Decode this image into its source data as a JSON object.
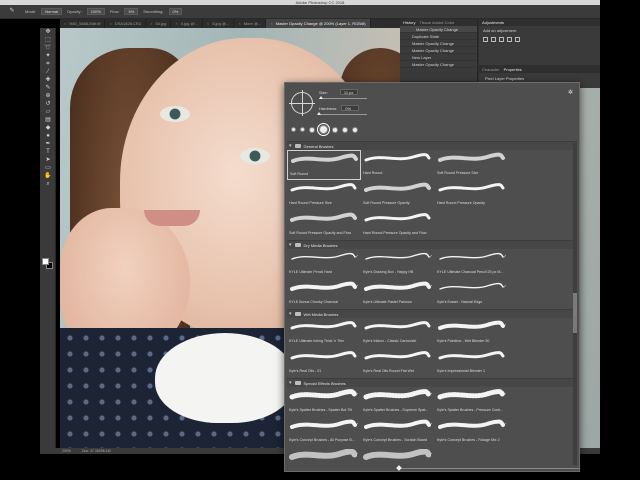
{
  "app": {
    "title": "Adobe Photoshop CC 2018"
  },
  "options_bar": {
    "mode_label": "Mode:",
    "mode_value": "Normal",
    "opacity_label": "Opacity:",
    "opacity_value": "100%",
    "flow_label": "Flow:",
    "flow_value": "5%",
    "smoothing_label": "Smoothing:",
    "smoothing_value": "0%"
  },
  "tabs": [
    {
      "label": "IMG_5888-Edit.tif"
    },
    {
      "label": "DSA1828.CR2"
    },
    {
      "label": "34.jpg"
    },
    {
      "label": "4.jpg @..."
    },
    {
      "label": "5.jpg @..."
    },
    {
      "label": "More @..."
    },
    {
      "label": "Master Opacity Change @ 200% (Layer 1, RGB/8)",
      "active": true
    }
  ],
  "history": {
    "tabs": [
      "History",
      "Tissue Adobe Color"
    ],
    "items": [
      "Master Opacity Change",
      "Duplicate State",
      "Master Opacity Change",
      "Master Opacity Change",
      "New Layer",
      "Master Opacity Change"
    ]
  },
  "adjustments": {
    "title": "Adjustments",
    "add_label": "Add an adjustment"
  },
  "properties": {
    "tabs": [
      "Character",
      "Properties"
    ],
    "item": "Pixel Layer Properties"
  },
  "status": {
    "zoom": "200%",
    "doc": "Doc: 47.1M/96.1M"
  },
  "picker": {
    "size_label": "Size:",
    "size_value": "11 px",
    "hardness_label": "Hardness:",
    "hardness_value": "0%",
    "size_fraction": 0.05,
    "hardness_fraction": 0.0,
    "groups": [
      {
        "name": "General Brushes",
        "rows": [
          [
            {
              "name": "Soft Round",
              "selected": true,
              "stroke": "soft"
            },
            {
              "name": "Hard Round",
              "stroke": "hard"
            },
            {
              "name": "Soft Round Pressure Size",
              "stroke": "soft"
            }
          ],
          [
            {
              "name": "Hard Round Pressure Size",
              "stroke": "hard"
            },
            {
              "name": "Soft Round Pressure Opacity",
              "stroke": "soft"
            },
            {
              "name": "Hard Round Pressure Opacity",
              "stroke": "hard"
            }
          ],
          [
            {
              "name": "Soft Round Pressure Opacity and Flow",
              "stroke": "soft"
            },
            {
              "name": "Hard Round Pressure Opacity and Flow",
              "stroke": "hard"
            }
          ]
        ]
      },
      {
        "name": "Dry Media Brushes",
        "rows": [
          [
            {
              "name": "KYLE Ultimate Pencil Hard",
              "stroke": "pencil"
            },
            {
              "name": "Kyle's Drawing Box - Happy HB",
              "stroke": "pencil"
            },
            {
              "name": "KYLE Ultimate Charcoal Pencil 25 px M...",
              "stroke": "pencil"
            }
          ],
          [
            {
              "name": "KYLE Bonus Chunky Charcoal",
              "stroke": "rough"
            },
            {
              "name": "Kyle's Ultimate Pastel Palooza",
              "stroke": "rough"
            },
            {
              "name": "Kyle's Eraser - Natural Edge",
              "stroke": "pencil"
            }
          ]
        ]
      },
      {
        "name": "Wet Media Brushes",
        "rows": [
          [
            {
              "name": "KYLE Ultimate Inking Thick 'n Thin",
              "stroke": "hard"
            },
            {
              "name": "Kyle's Inkbox - Classic Cartoonist",
              "stroke": "hard"
            },
            {
              "name": "Kyle's Paintbox - Wet Blender 50",
              "stroke": "rough"
            }
          ],
          [
            {
              "name": "Kyle's Real Oils - 01",
              "stroke": "hard"
            },
            {
              "name": "Kyle's Real Oils Round Flat Wet",
              "stroke": "hard"
            },
            {
              "name": "Kyle's Impressionist Blender 1",
              "stroke": "hard"
            }
          ]
        ]
      },
      {
        "name": "Special Effects Brushes",
        "rows": [
          [
            {
              "name": "Kyle's Spatter Brushes - Spatter Bot Tilt",
              "stroke": "spatter"
            },
            {
              "name": "Kyle's Spatter Brushes - Supreme Spat...",
              "stroke": "spatter"
            },
            {
              "name": "Kyle's Spatter Brushes - Pressure Contr...",
              "stroke": "spatter"
            }
          ],
          [
            {
              "name": "Kyle's Concept Brushes - All Purpose B...",
              "stroke": "rough"
            },
            {
              "name": "Kyle's Concept Brushes - Scratch Board",
              "stroke": "rough"
            },
            {
              "name": "Kyle's Concept Brushes - Foliage Mix 2",
              "stroke": "rough"
            }
          ],
          [
            {
              "name": "Kyle's Screentones 29",
              "stroke": "dots"
            },
            {
              "name": "Kyle's Screentones 38",
              "stroke": "dots"
            }
          ]
        ]
      }
    ]
  },
  "tools": [
    "move-tool",
    "marquee-tool",
    "lasso-tool",
    "quick-select-tool",
    "crop-tool",
    "eyedropper-tool",
    "healing-tool",
    "brush-tool",
    "clone-tool",
    "history-brush-tool",
    "eraser-tool",
    "gradient-tool",
    "blur-tool",
    "dodge-tool",
    "pen-tool",
    "type-tool",
    "path-select-tool",
    "shape-tool",
    "hand-tool",
    "zoom-tool"
  ]
}
